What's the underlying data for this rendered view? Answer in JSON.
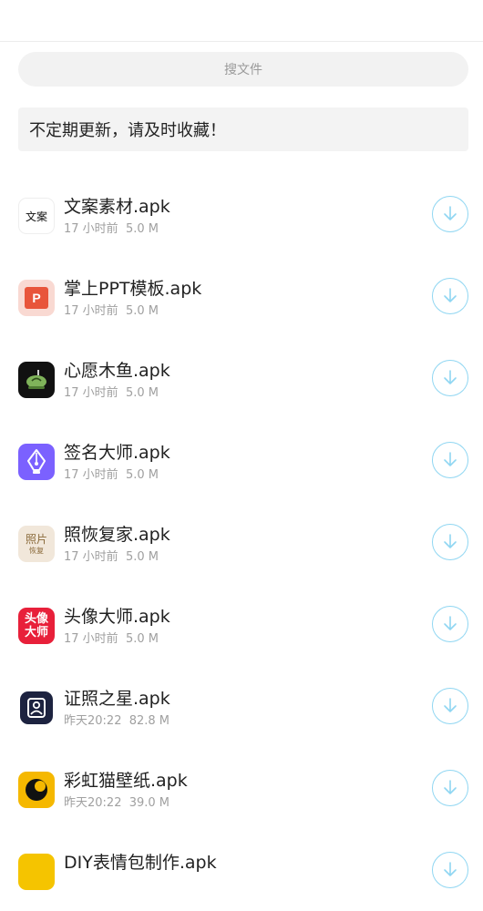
{
  "search": {
    "placeholder": "搜文件"
  },
  "notice": {
    "text": "不定期更新，请及时收藏！"
  },
  "files": [
    {
      "name": "文案素材.apk",
      "time": "17 小时前",
      "size": "5.0 M",
      "icon": "wenan-app-icon",
      "icon_text": "文案"
    },
    {
      "name": "掌上PPT模板.apk",
      "time": "17 小时前",
      "size": "5.0 M",
      "icon": "ppt-app-icon",
      "icon_text": "P"
    },
    {
      "name": "心愿木鱼.apk",
      "time": "17 小时前",
      "size": "5.0 M",
      "icon": "wooden-fish-app-icon"
    },
    {
      "name": "签名大师.apk",
      "time": "17 小时前",
      "size": "5.0 M",
      "icon": "pen-nib-app-icon"
    },
    {
      "name": "照恢复家.apk",
      "time": "17 小时前",
      "size": "5.0 M",
      "icon": "photo-restore-app-icon",
      "icon_text_top": "照片",
      "icon_text_bottom": "恢复"
    },
    {
      "name": "头像大师.apk",
      "time": "17 小时前",
      "size": "5.0 M",
      "icon": "avatar-master-app-icon",
      "icon_text_top": "头像",
      "icon_text_bottom": "大师"
    },
    {
      "name": "证照之星.apk",
      "time": "昨天20:22",
      "size": "82.8 M",
      "icon": "id-photo-app-icon"
    },
    {
      "name": "彩虹猫壁纸.apk",
      "time": "昨天20:22",
      "size": "39.0 M",
      "icon": "rainbow-cat-app-icon"
    },
    {
      "name": "DIY表情包制作.apk",
      "time": "",
      "size": "",
      "icon": "diy-emoji-app-icon"
    }
  ],
  "colors": {
    "download_ring": "#8fd6f2",
    "ppt": "#e8553b",
    "signature": "#7b61ff",
    "avatar": "#e8203a",
    "idphoto": "#1d2340",
    "rainbowcat": "#f5b800"
  }
}
